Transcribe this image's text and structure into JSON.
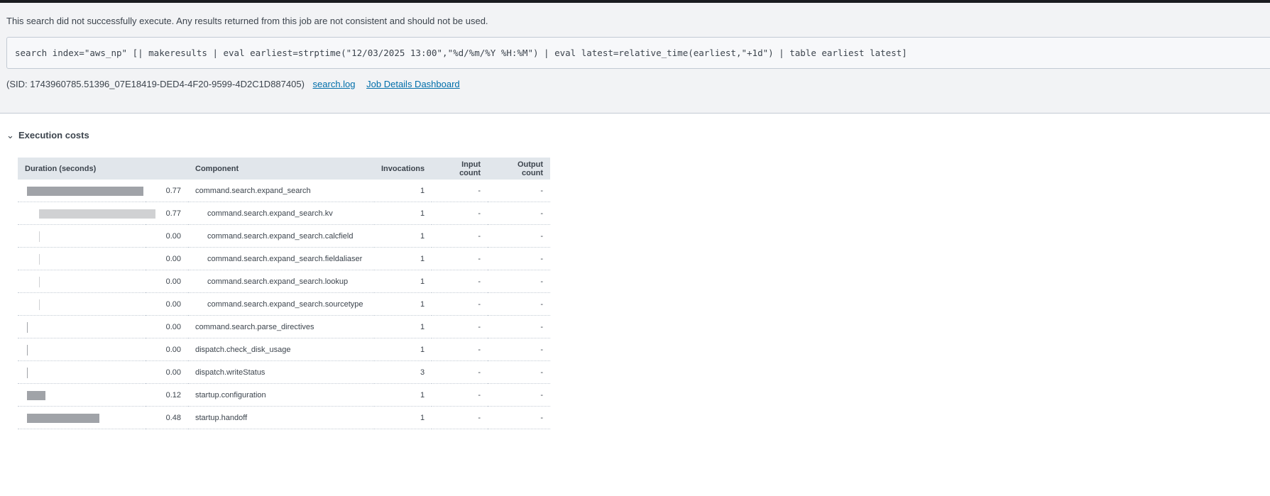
{
  "header": {
    "warning": "This search did not successfully execute. Any results returned from this job are not consistent and should not be used.",
    "query": "search index=\"aws_np\" [| makeresults | eval earliest=strptime(\"12/03/2025 13:00\",\"%d/%m/%Y %H:%M\") | eval latest=relative_time(earliest,\"+1d\") | table earliest latest]",
    "sid": "(SID: 1743960785.51396_07E18419-DED4-4F20-9599-4D2C1D887405)",
    "search_log_link": "search.log",
    "job_details_link": "Job Details Dashboard"
  },
  "section": {
    "title": "Execution costs",
    "chevron": "chevron-down-icon"
  },
  "table": {
    "columns": [
      "Duration (seconds)",
      "Component",
      "Invocations",
      "Input count",
      "Output count"
    ],
    "max_duration": 0.77,
    "rows": [
      {
        "duration": "0.77",
        "component": "command.search.expand_search",
        "invocations": "1",
        "input": "-",
        "output": "-",
        "child": false
      },
      {
        "duration": "0.77",
        "component": "command.search.expand_search.kv",
        "invocations": "1",
        "input": "-",
        "output": "-",
        "child": true
      },
      {
        "duration": "0.00",
        "component": "command.search.expand_search.calcfield",
        "invocations": "1",
        "input": "-",
        "output": "-",
        "child": true
      },
      {
        "duration": "0.00",
        "component": "command.search.expand_search.fieldaliaser",
        "invocations": "1",
        "input": "-",
        "output": "-",
        "child": true
      },
      {
        "duration": "0.00",
        "component": "command.search.expand_search.lookup",
        "invocations": "1",
        "input": "-",
        "output": "-",
        "child": true
      },
      {
        "duration": "0.00",
        "component": "command.search.expand_search.sourcetype",
        "invocations": "1",
        "input": "-",
        "output": "-",
        "child": true
      },
      {
        "duration": "0.00",
        "component": "command.search.parse_directives",
        "invocations": "1",
        "input": "-",
        "output": "-",
        "child": false
      },
      {
        "duration": "0.00",
        "component": "dispatch.check_disk_usage",
        "invocations": "1",
        "input": "-",
        "output": "-",
        "child": false
      },
      {
        "duration": "0.00",
        "component": "dispatch.writeStatus",
        "invocations": "3",
        "input": "-",
        "output": "-",
        "child": false
      },
      {
        "duration": "0.12",
        "component": "startup.configuration",
        "invocations": "1",
        "input": "-",
        "output": "-",
        "child": false
      },
      {
        "duration": "0.48",
        "component": "startup.handoff",
        "invocations": "1",
        "input": "-",
        "output": "-",
        "child": false
      }
    ]
  },
  "colors": {
    "parent_bar": "#a0a3a8",
    "child_bar": "#d0d1d3",
    "link": "#006eaa"
  }
}
